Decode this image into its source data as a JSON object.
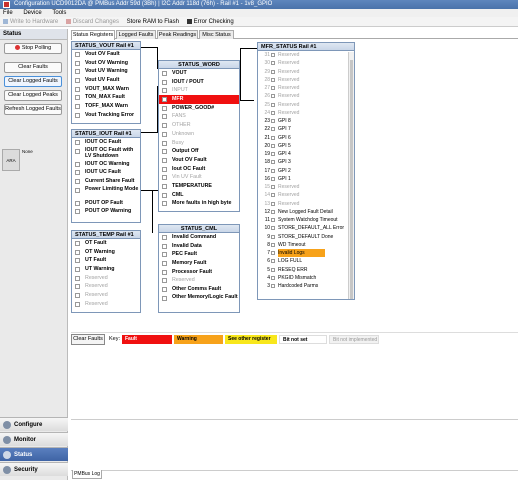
{
  "window": {
    "title": "Configuration UCD9012DA @ PMBus Addr 59d (3Bh) | I2C Addr 118d (76h) - Rail #1 - 1v8_GPIO"
  },
  "menu": [
    "File",
    "Device",
    "Tools"
  ],
  "toolbar": [
    {
      "label": "Write to Hardware",
      "icon": "write-icon",
      "enabled": false
    },
    {
      "label": "Discard Changes",
      "icon": "discard-icon",
      "enabled": false
    },
    {
      "label": "Store RAM to Flash",
      "icon": "",
      "enabled": true
    },
    {
      "label": "Error Checking",
      "icon": "error-checking-icon",
      "enabled": true
    }
  ],
  "sidebar": {
    "title": "Status",
    "buttons": [
      "Stop Polling",
      "Clear Faults",
      "Clear Logged Faults",
      "Clear Logged Peaks",
      "Refresh Logged Faults"
    ],
    "ara_label": "ARA",
    "ara_value": "None"
  },
  "nav": [
    "Configure",
    "Monitor",
    "Status",
    "Security"
  ],
  "tabs": [
    "Status Registers",
    "Logged Faults",
    "Peak Readings",
    "Misc Status"
  ],
  "colors": {
    "fault": "#f01010",
    "warning": "#f7a21a",
    "other_register": "#f8e71c",
    "not_set": "#ffffff",
    "not_implemented": "#f2f2f2"
  },
  "status_vout": {
    "title": "STATUS_VOUT Rail #1",
    "rows": [
      {
        "label": "Vout OV Fault"
      },
      {
        "label": "Vout OV Warning"
      },
      {
        "label": "Vout UV Warning"
      },
      {
        "label": "Vout UV Fault"
      },
      {
        "label": "VOUT_MAX Warn"
      },
      {
        "label": "TON_MAX Fault"
      },
      {
        "label": "TOFF_MAX Warn"
      },
      {
        "label": "Vout Tracking Error"
      }
    ]
  },
  "status_iout": {
    "title": "STATUS_IOUT Rail #1",
    "rows": [
      {
        "label": "IOUT OC Fault"
      },
      {
        "label": "IOUT OC Fault with LV Shutdown",
        "two": true
      },
      {
        "label": "IOUT OC Warning"
      },
      {
        "label": "IOUT UC Fault"
      },
      {
        "label": "Current Share Fault"
      },
      {
        "label": "Power Limiting Mode",
        "two": true
      },
      {
        "label": "POUT OP Fault"
      },
      {
        "label": "POUT OP Warning"
      }
    ]
  },
  "status_temp": {
    "title": "STATUS_TEMP Rail #1",
    "rows": [
      {
        "label": "OT Fault"
      },
      {
        "label": "OT Warning"
      },
      {
        "label": "UT Fault"
      },
      {
        "label": "UT Warning"
      },
      {
        "label": "Reserved",
        "dim": true
      },
      {
        "label": "Reserved",
        "dim": true
      },
      {
        "label": "Reserved",
        "dim": true
      },
      {
        "label": "Reserved",
        "dim": true
      }
    ]
  },
  "status_word": {
    "title": "STATUS_WORD",
    "rows": [
      {
        "label": "VOUT"
      },
      {
        "label": "IOUT / POUT"
      },
      {
        "label": "INPUT",
        "dim": true
      },
      {
        "label": "MFR",
        "state": "fault"
      },
      {
        "label": "POWER_GOOD#"
      },
      {
        "label": "FANS",
        "dim": true
      },
      {
        "label": "OTHER",
        "dim": true
      },
      {
        "label": "Unknown",
        "dim": true
      },
      {
        "label": "Busy",
        "dim": true
      },
      {
        "label": "Output Off"
      },
      {
        "label": "Vout OV Fault"
      },
      {
        "label": "Iout OC Fault"
      },
      {
        "label": "Vin UV Fault",
        "dim": true
      },
      {
        "label": "TEMPERATURE"
      },
      {
        "label": "CML"
      },
      {
        "label": "More faults in high byte"
      }
    ]
  },
  "status_cml": {
    "title": "STATUS_CML",
    "rows": [
      {
        "label": "Invalid Command"
      },
      {
        "label": "Invalid Data"
      },
      {
        "label": "PEC Fault"
      },
      {
        "label": "Memory Fault"
      },
      {
        "label": "Processor Fault"
      },
      {
        "label": "Reserved",
        "dim": true
      },
      {
        "label": "Other Comms Fault"
      },
      {
        "label": "Other Memory/Logic Fault",
        "two": true
      }
    ]
  },
  "mfr_status": {
    "title": "MFR_STATUS Rail #1",
    "rows": [
      {
        "num": "31",
        "label": "Reserved",
        "dim": true
      },
      {
        "num": "30",
        "label": "Reserved",
        "dim": true
      },
      {
        "num": "29",
        "label": "Reserved",
        "dim": true
      },
      {
        "num": "28",
        "label": "Reserved",
        "dim": true
      },
      {
        "num": "27",
        "label": "Reserved",
        "dim": true
      },
      {
        "num": "26",
        "label": "Reserved",
        "dim": true
      },
      {
        "num": "25",
        "label": "Reserved",
        "dim": true
      },
      {
        "num": "24",
        "label": "Reserved",
        "dim": true
      },
      {
        "num": "23",
        "label": "GPI 8"
      },
      {
        "num": "22",
        "label": "GPI 7"
      },
      {
        "num": "21",
        "label": "GPI 6"
      },
      {
        "num": "20",
        "label": "GPI 5"
      },
      {
        "num": "19",
        "label": "GPI 4"
      },
      {
        "num": "18",
        "label": "GPI 3"
      },
      {
        "num": "17",
        "label": "GPI 2"
      },
      {
        "num": "16",
        "label": "GPI 1"
      },
      {
        "num": "15",
        "label": "Reserved",
        "dim": true
      },
      {
        "num": "14",
        "label": "Reserved",
        "dim": true
      },
      {
        "num": "13",
        "label": "Reserved",
        "dim": true
      },
      {
        "num": "12",
        "label": "New Logged Fault Detail"
      },
      {
        "num": "11",
        "label": "System Watchdog Timeout"
      },
      {
        "num": "10",
        "label": "STORE_DEFAULT_ALL Error"
      },
      {
        "num": "9",
        "label": "STORE_DEFAULT Done"
      },
      {
        "num": "8",
        "label": "WD Timeout"
      },
      {
        "num": "7",
        "label": "Invalid Logs",
        "state": "warn"
      },
      {
        "num": "6",
        "label": "LOG FULL"
      },
      {
        "num": "5",
        "label": "RESEQ ERR"
      },
      {
        "num": "4",
        "label": "PKGID Mismatch"
      },
      {
        "num": "3",
        "label": "Hardcoded Parms"
      }
    ]
  },
  "key": {
    "clear_label": "Clear Faults",
    "label": "Key:",
    "items": [
      {
        "label": "Fault",
        "color": "#f01010",
        "text": "#ffffff"
      },
      {
        "label": "Warning",
        "color": "#f7a21a",
        "text": "#000000"
      },
      {
        "label": "See other register",
        "color": "#f8e71c",
        "text": "#000000"
      },
      {
        "label": "Bit not set",
        "color": "#ffffff",
        "text": "#000000"
      },
      {
        "label": "Bit not implemented",
        "color": "#f2f2f2",
        "text": "#999999"
      }
    ]
  },
  "log_tab": "PMBus Log"
}
